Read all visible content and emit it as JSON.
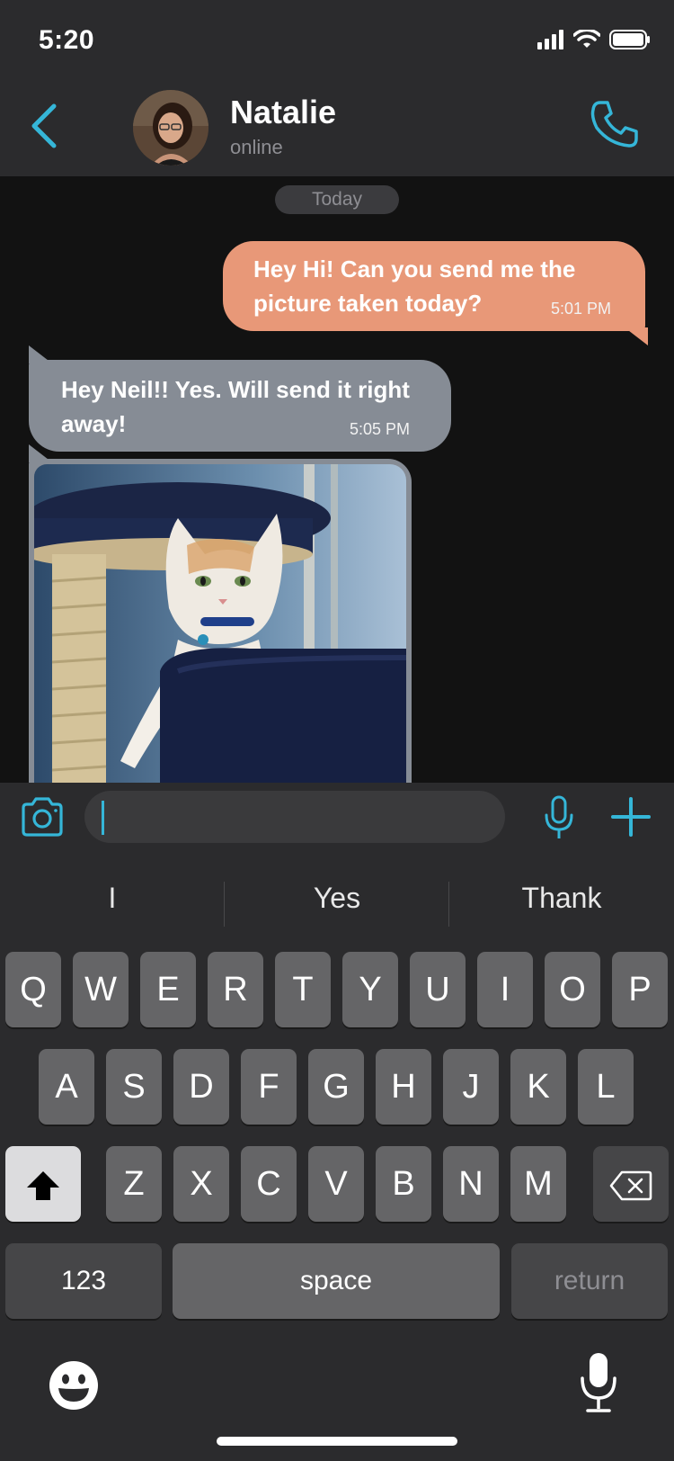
{
  "status_bar": {
    "time": "5:20"
  },
  "header": {
    "contact_name": "Natalie",
    "contact_status": "online"
  },
  "chat": {
    "date_label": "Today",
    "messages": [
      {
        "direction": "outgoing",
        "text": "Hey Hi! Can you send me the picture taken today?",
        "time": "5:01 PM"
      },
      {
        "direction": "incoming",
        "text": "Hey Neil!! Yes. Will send it right away!",
        "time": "5:05 PM"
      },
      {
        "direction": "incoming",
        "type": "photo"
      }
    ]
  },
  "composer": {
    "value": "",
    "placeholder": ""
  },
  "keyboard": {
    "suggestions": [
      "I",
      "Yes",
      "Thank"
    ],
    "row1": [
      "Q",
      "W",
      "E",
      "R",
      "T",
      "Y",
      "U",
      "I",
      "O",
      "P"
    ],
    "row2": [
      "A",
      "S",
      "D",
      "F",
      "G",
      "H",
      "J",
      "K",
      "L"
    ],
    "row3": [
      "Z",
      "X",
      "C",
      "V",
      "B",
      "N",
      "M"
    ],
    "numbers_label": "123",
    "space_label": "space",
    "return_label": "return"
  },
  "colors": {
    "accent": "#35b6d8",
    "outgoing_bubble": "#e89878",
    "incoming_bubble": "#868c95",
    "header_bg": "#2b2b2d",
    "chat_bg": "#121212"
  },
  "icons": [
    "back-chevron",
    "avatar",
    "phone",
    "camera",
    "microphone",
    "plus",
    "shift",
    "delete",
    "emoji",
    "dictation-mic"
  ]
}
